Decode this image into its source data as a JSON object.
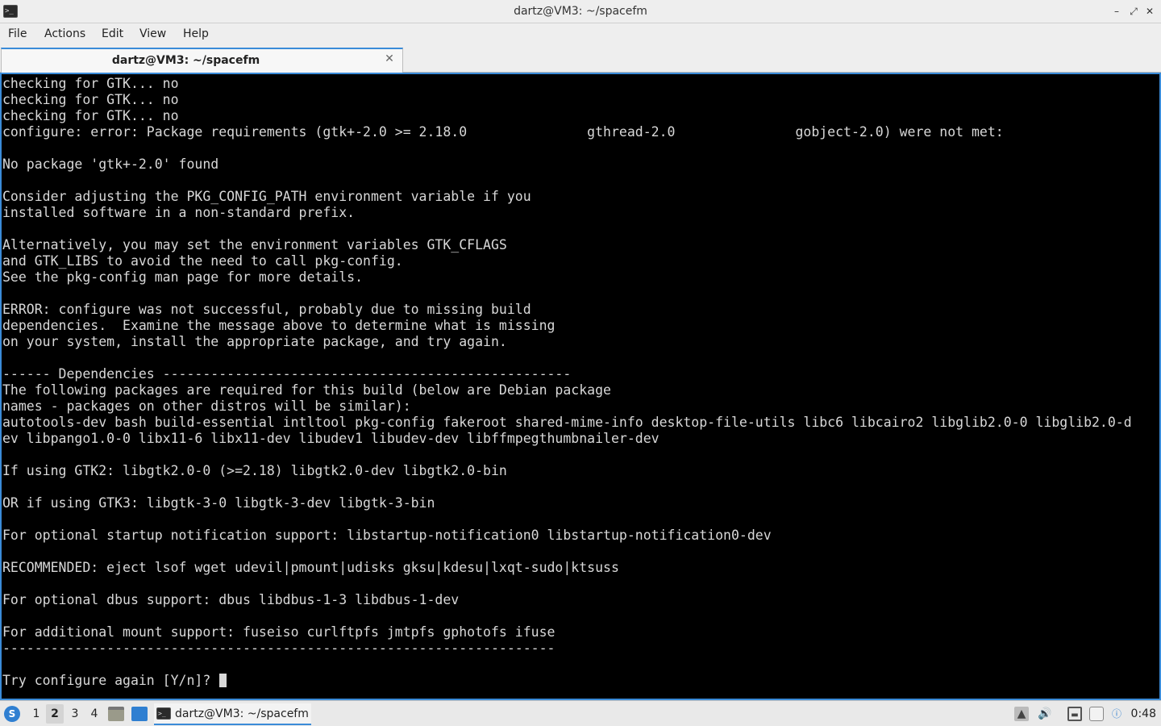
{
  "window": {
    "title": "dartz@VM3: ~/spacefm",
    "minimize_glyph": "–",
    "maximize_glyph": "⤢",
    "close_glyph": "✕"
  },
  "menu": {
    "items": [
      "File",
      "Actions",
      "Edit",
      "View",
      "Help"
    ]
  },
  "tabs": [
    {
      "label": "dartz@VM3: ~/spacefm",
      "close_glyph": "✕"
    }
  ],
  "terminal": {
    "lines": [
      "checking for GTK... no",
      "checking for GTK... no",
      "checking for GTK... no",
      "configure: error: Package requirements (gtk+-2.0 >= 2.18.0               gthread-2.0               gobject-2.0) were not met:",
      "",
      "No package 'gtk+-2.0' found",
      "",
      "Consider adjusting the PKG_CONFIG_PATH environment variable if you",
      "installed software in a non-standard prefix.",
      "",
      "Alternatively, you may set the environment variables GTK_CFLAGS",
      "and GTK_LIBS to avoid the need to call pkg-config.",
      "See the pkg-config man page for more details.",
      "",
      "ERROR: configure was not successful, probably due to missing build",
      "dependencies.  Examine the message above to determine what is missing",
      "on your system, install the appropriate package, and try again.",
      "",
      "------ Dependencies ---------------------------------------------------",
      "The following packages are required for this build (below are Debian package",
      "names - packages on other distros will be similar):",
      "autotools-dev bash build-essential intltool pkg-config fakeroot shared-mime-info desktop-file-utils libc6 libcairo2 libglib2.0-0 libglib2.0-d",
      "ev libpango1.0-0 libx11-6 libx11-dev libudev1 libudev-dev libffmpegthumbnailer-dev",
      "",
      "If using GTK2: libgtk2.0-0 (>=2.18) libgtk2.0-dev libgtk2.0-bin",
      "",
      "OR if using GTK3: libgtk-3-0 libgtk-3-dev libgtk-3-bin",
      "",
      "For optional startup notification support: libstartup-notification0 libstartup-notification0-dev",
      "",
      "RECOMMENDED: eject lsof wget udevil|pmount|udisks gksu|kdesu|lxqt-sudo|ktsuss",
      "",
      "For optional dbus support: dbus libdbus-1-3 libdbus-1-dev",
      "",
      "For additional mount support: fuseiso curlftpfs jmtpfs gphotofs ifuse",
      "---------------------------------------------------------------------",
      "",
      "Try configure again [Y/n]? "
    ]
  },
  "taskbar": {
    "workspaces": [
      "1",
      "2",
      "3",
      "4"
    ],
    "active_workspace": "2",
    "task_label": "dartz@VM3: ~/spacefm",
    "clock": "0:48"
  },
  "icons": {
    "app": "terminal-icon",
    "start": "lxqt-start-icon",
    "tray": [
      "notes-icon",
      "volume-icon",
      "network-icon",
      "clipboard-icon",
      "update-notifier-icon"
    ]
  },
  "colors": {
    "accent": "#3a8bd8",
    "terminal_bg": "#000000",
    "terminal_fg": "#d8d8d8",
    "chrome_bg": "#eeeeee"
  }
}
